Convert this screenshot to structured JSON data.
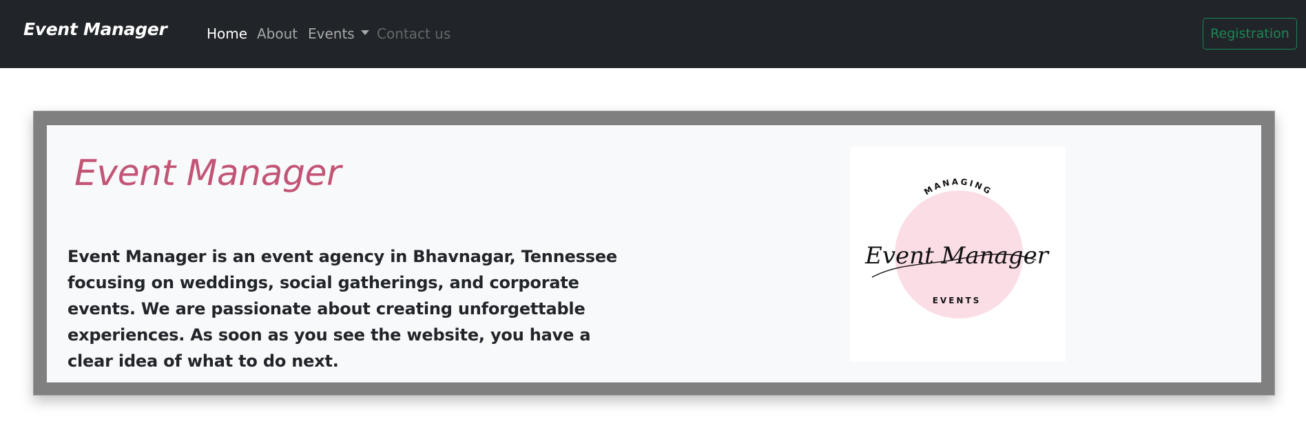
{
  "navbar": {
    "brand": "Event Manager",
    "links": [
      {
        "label": "Home",
        "state": "active"
      },
      {
        "label": "About",
        "state": "normal"
      },
      {
        "label": "Events",
        "state": "dropdown"
      },
      {
        "label": "Contact us",
        "state": "disabled"
      }
    ],
    "registration_label": "Registration"
  },
  "hero": {
    "title": "Event Manager",
    "description": "Event Manager is an event agency in Bhavnagar, Tennessee focusing on weddings, social gatherings, and corporate events. We are passionate about creating unforgettable experiences. As soon as you see the website, you have a clear idea of what to do next.",
    "logo": {
      "top_text": "MANAGING",
      "script_text": "Event Manager",
      "bottom_text": "EVENTS",
      "circle_color": "#fbdde6"
    }
  },
  "colors": {
    "navbar_bg": "#212529",
    "registration": "#198754",
    "title": "#c25576",
    "frame": "#808080",
    "hero_bg": "#f8f9fa"
  }
}
